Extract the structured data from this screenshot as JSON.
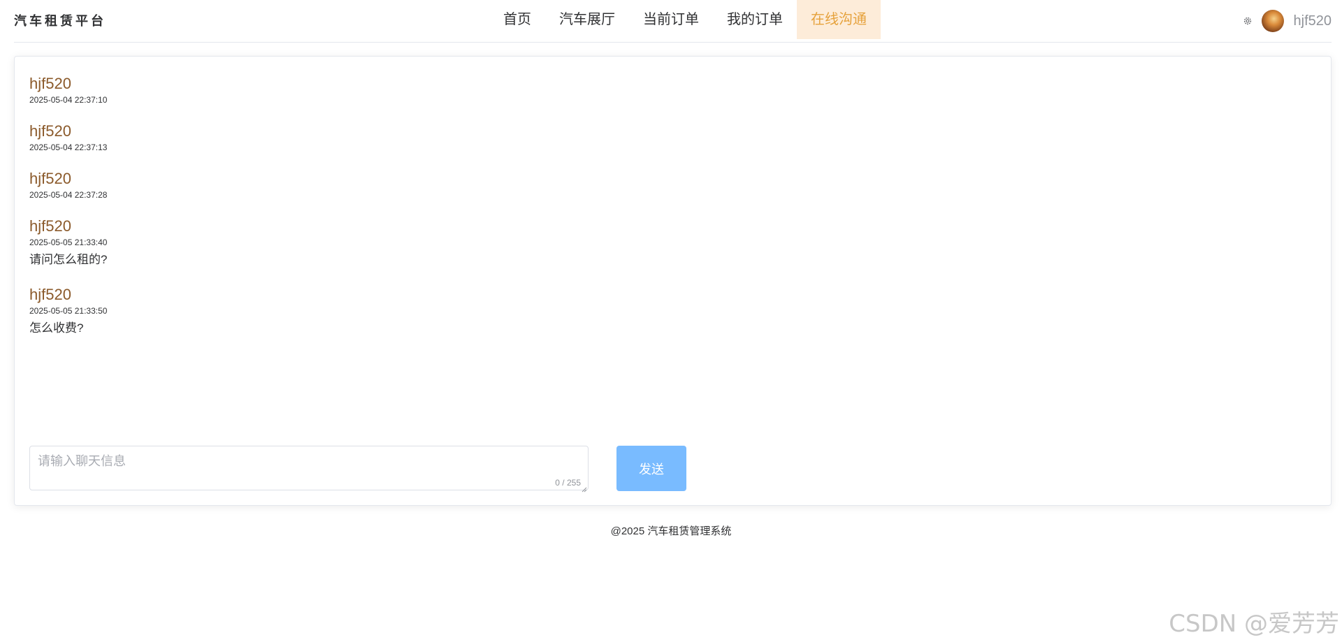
{
  "header": {
    "brand": "汽车租赁平台",
    "nav": [
      {
        "label": "首页",
        "active": false
      },
      {
        "label": "汽车展厅",
        "active": false
      },
      {
        "label": "当前订单",
        "active": false
      },
      {
        "label": "我的订单",
        "active": false
      },
      {
        "label": "在线沟通",
        "active": true
      }
    ],
    "settings_icon": "gear-icon",
    "username": "hjf520"
  },
  "chat": {
    "messages": [
      {
        "user": "hjf520",
        "time": "2025-05-04 22:37:10",
        "text": ""
      },
      {
        "user": "hjf520",
        "time": "2025-05-04 22:37:13",
        "text": ""
      },
      {
        "user": "hjf520",
        "time": "2025-05-04 22:37:28",
        "text": ""
      },
      {
        "user": "hjf520",
        "time": "2025-05-05 21:33:40",
        "text": "请问怎么租的?"
      },
      {
        "user": "hjf520",
        "time": "2025-05-05 21:33:50",
        "text": "怎么收费?"
      }
    ],
    "input": {
      "placeholder": "请输入聊天信息",
      "value": "",
      "word_count": "0 / 255"
    },
    "send_label": "发送"
  },
  "footer": {
    "text": "@2025 汽车租赁管理系统"
  },
  "watermark": "CSDN @爱芳芳",
  "colors": {
    "accent": "#e6a23c",
    "active_nav_bg": "#fdecd9",
    "username_color": "#8b5a2b",
    "send_button": "#79bbff"
  }
}
